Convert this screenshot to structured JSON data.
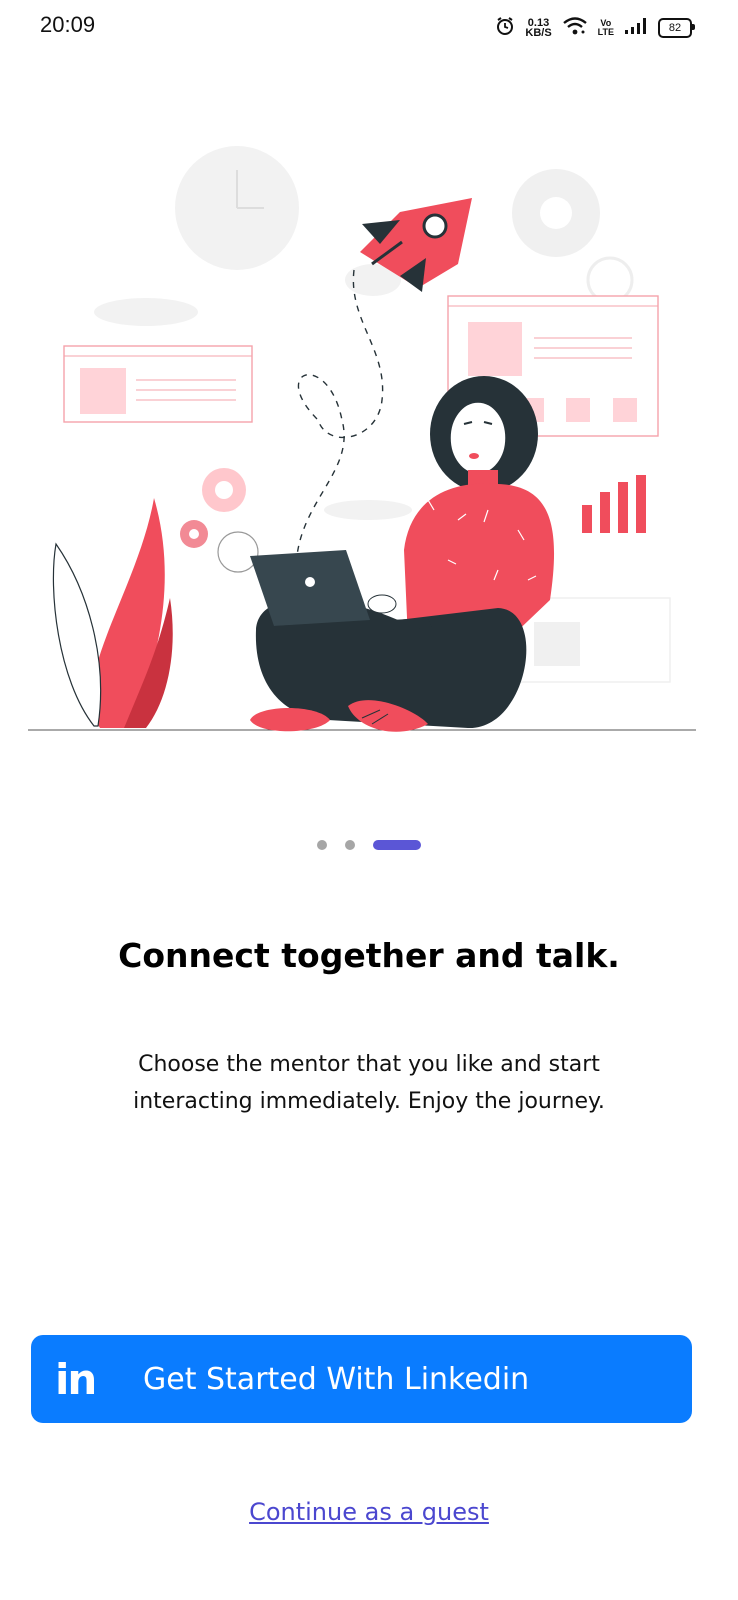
{
  "status_bar": {
    "time": "20:09",
    "net_speed_value": "0.13",
    "net_speed_unit": "KB/S",
    "volte_top": "Vo",
    "volte_bottom": "LTE",
    "battery": "82",
    "icons": [
      "alarm-icon",
      "wifi-icon",
      "signal-icon",
      "battery-icon"
    ]
  },
  "illustration": {
    "subject": "woman-with-laptop-rocket-illustration",
    "accent_color": "#f04d5c",
    "dark_color": "#263238"
  },
  "pager": {
    "count": 3,
    "active_index": 2,
    "active_color": "#5b56d6"
  },
  "onboarding": {
    "title": "Connect together and talk.",
    "subtitle": "Choose the mentor that you like and start interacting immediately. Enjoy the journey."
  },
  "actions": {
    "linkedin_icon": "in",
    "linkedin_label": "Get Started With Linkedin",
    "linkedin_color": "#0a7cff",
    "guest_label": "Continue as a guest"
  }
}
